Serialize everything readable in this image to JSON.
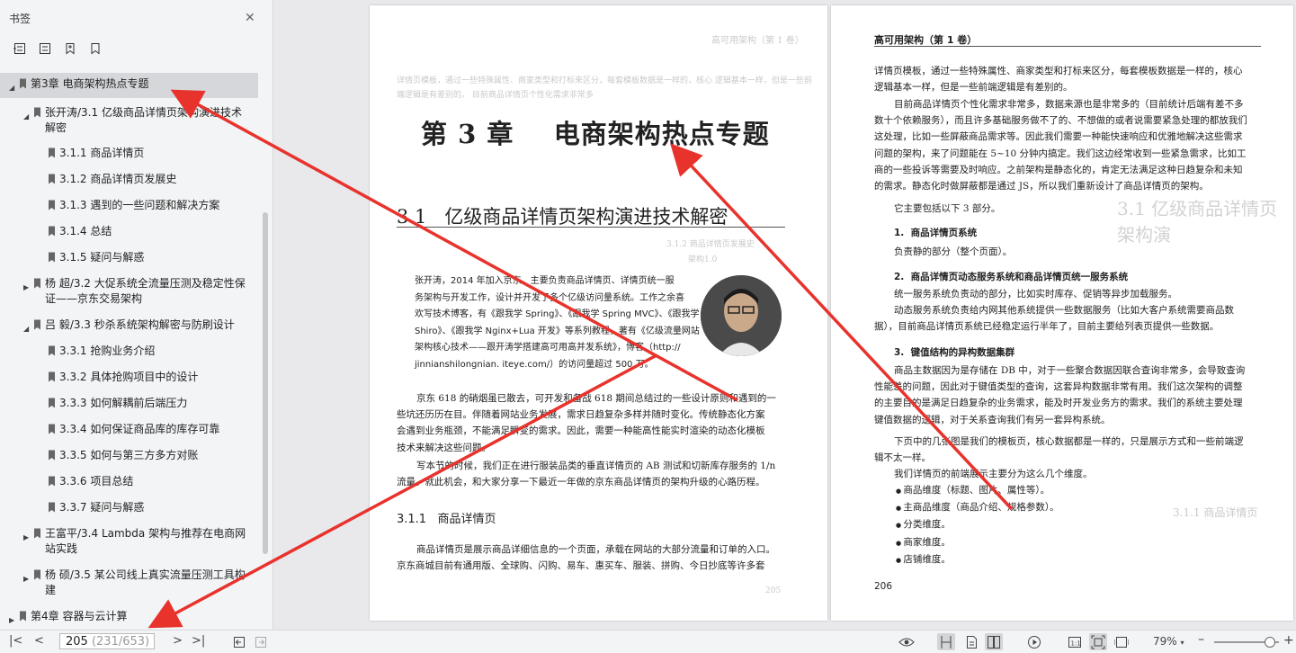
{
  "sidebar": {
    "title": "书签",
    "close_icon": "close-icon",
    "tools": [
      "expand-all-icon",
      "collapse-all-icon",
      "add-bookmark-icon",
      "bookmark-icon"
    ],
    "items": [
      {
        "label": "第3章 电商架构热点专题",
        "level": 0,
        "toggle": "▲"
      },
      {
        "label": "张开涛/3.1 亿级商品详情页架构演进技术",
        "label2": "解密",
        "level": 1,
        "toggle": "▲"
      },
      {
        "label": "3.1.1 商品详情页",
        "level": 2
      },
      {
        "label": "3.1.2 商品详情页发展史",
        "level": 2
      },
      {
        "label": "3.1.3 遇到的一些问题和解决方案",
        "level": 2
      },
      {
        "label": "3.1.4 总结",
        "level": 2
      },
      {
        "label": "3.1.5 疑问与解惑",
        "level": 2
      },
      {
        "label": "杨 超/3.2 大促系统全流量压测及稳定性保",
        "label2": "证——京东交易架构",
        "level": 1,
        "toggle": "▶"
      },
      {
        "label": "吕 毅/3.3 秒杀系统架构解密与防刷设计",
        "level": 1,
        "toggle": "▲"
      },
      {
        "label": "3.3.1 抢购业务介绍",
        "level": 2
      },
      {
        "label": "3.3.2 具体抢购项目中的设计",
        "level": 2
      },
      {
        "label": "3.3.3 如何解耦前后端压力",
        "level": 2
      },
      {
        "label": "3.3.4 如何保证商品库的库存可靠",
        "level": 2
      },
      {
        "label": "3.3.5 如何与第三方多方对账",
        "level": 2
      },
      {
        "label": "3.3.6 项目总结",
        "level": 2
      },
      {
        "label": "3.3.7 疑问与解惑",
        "level": 2
      },
      {
        "label": "王富平/3.4 Lambda 架构与推荐在电商网",
        "label2": "站实践",
        "level": 1,
        "toggle": "▶"
      },
      {
        "label": "杨 硕/3.5 某公司线上真实流量压测工具构",
        "label2": "建",
        "level": 1,
        "toggle": "▶"
      },
      {
        "label": "第4章 容器与云计算",
        "level": 0,
        "toggle": "▶"
      }
    ]
  },
  "left_page": {
    "chapter_title": "第 3 章    电商架构热点专题",
    "section_title": "3.1   亿级商品详情页架构演进技术解密",
    "bio": [
      "张开涛，2014 年加入京东，主要负责商品详情页、详情页统一服",
      "务架构与开发工作，设计并开发了多个亿级访问量系统。工作之余喜",
      "欢写技术博客，有《跟我学 Spring》、《跟我学 Spring MVC》、《跟我学",
      "Shiro》、《跟我学 Nginx+Lua 开发》等系列教程，著有《亿级流量网站",
      "架构核心技术——跟开涛学搭建高可用高并发系统》，博客（http://",
      "jinnianshilongnian. iteye.com/）的访问量超过 500 万。"
    ],
    "para1": [
      "京东 618 的硝烟虽已散去，可开发和备战 618 期间总结过的一些设计原则和遇到的一",
      "些坑还历历在目。伴随着网站业务发展，需求日趋复杂多样并随时变化。传统静态化方案",
      "会遇到业务瓶颈，不能满足瞬变的需求。因此，需要一种能高性能实时渲染的动态化模板",
      "技术来解决这些问题。"
    ],
    "para2": [
      "写本节的时候，我们正在进行服装品类的垂直详情页的 AB 测试和切新库存服务的 1/n",
      "流量。就此机会，和大家分享一下最近一年做的京东商品详情页的架构升级的心路历程。"
    ],
    "subsection": "3.1.1   商品详情页",
    "para3": [
      "商品详情页是展示商品详细信息的一个页面，承载在网站的大部分流量和订单的入口。",
      "京东商城目前有通用版、全球购、闪购、易车、惠买车、服装、拼购、今日抄底等许多套"
    ]
  },
  "right_page": {
    "header": "高可用架构（第 1 卷）",
    "para1": [
      "详情页模板，通过一些特殊属性、商家类型和打标来区分，每套模板数据是一样的，核心",
      "逻辑基本一样，但是一些前端逻辑是有差别的。"
    ],
    "para2": [
      "目前商品详情页个性化需求非常多，数据来源也是非常多的（目前统计后端有差不多",
      "数十个依赖服务），而且许多基础服务做不了的、不想做的或者说需要紧急处理的都放我们",
      "这处理，比如一些屏蔽商品需求等。因此我们需要一种能快速响应和优雅地解决这些需求",
      "问题的架构，来了问题能在 5~10 分钟内搞定。我们这边经常收到一些紧急需求，比如工",
      "商的一些投诉等需要及时响应。之前架构是静态化的，肯定无法满足这种日趋复杂和未知",
      "的需求。静态化时做屏蔽都是通过 JS，所以我们重新设计了商品详情页的架构。"
    ],
    "intro": "它主要包括以下 3 部分。",
    "h1": "1.  商品详情页系统",
    "h1_text": "负责静的部分（整个页面）。",
    "h2": "2.  商品详情页动态服务系统和商品详情页统一服务系统",
    "h2_text": [
      "统一服务系统负责动的部分，比如实时库存、促销等异步加载服务。",
      "动态服务系统负责给内网其他系统提供一些数据服务（比如大客户系统需要商品数",
      "据），目前商品详情页系统已经稳定运行半年了，目前主要给列表页提供一些数据。"
    ],
    "h3": "3.  键值结构的异构数据集群",
    "h3_text": [
      "商品主数据因为是存储在 DB 中，对于一些聚合数据因联合查询非常多，会导致查询",
      "性能差的问题，因此对于键值类型的查询，这套异构数据非常有用。我们这次架构的调整",
      "的主要目的是满足日趋复杂的业务需求，能及时开发业务方的需求。我们的系统主要处理",
      "键值数据的逻辑，对于关系查询我们有另一套异构系统。"
    ],
    "para3": [
      "下页中的几张图是我们的模板页，核心数据都是一样的，只是展示方式和一些前端逻",
      "辑不太一样。"
    ],
    "para4": "我们详情页的前端展示主要分为这么几个维度。",
    "bullets": [
      "商品维度（标题、图片、属性等）。",
      "主商品维度（商品介绍、规格参数）。",
      "分类维度。",
      "商家维度。",
      "店铺维度。"
    ],
    "page_number": "206"
  },
  "bottom_bar": {
    "current_page": "205",
    "page_total": "(231/653)",
    "zoom": "79%",
    "zoom_level": 0.79,
    "view_icons": [
      "eye-icon",
      "single-page-icon",
      "continuous-page-icon",
      "two-page-icon",
      "play-icon",
      "actual-size-icon",
      "fit-page-icon",
      "fit-width-icon"
    ]
  },
  "colors": {
    "annotation_arrow": "#e8332d",
    "sidebar_bg": "#f3f4f6",
    "selected_row": "#d6d7da"
  }
}
